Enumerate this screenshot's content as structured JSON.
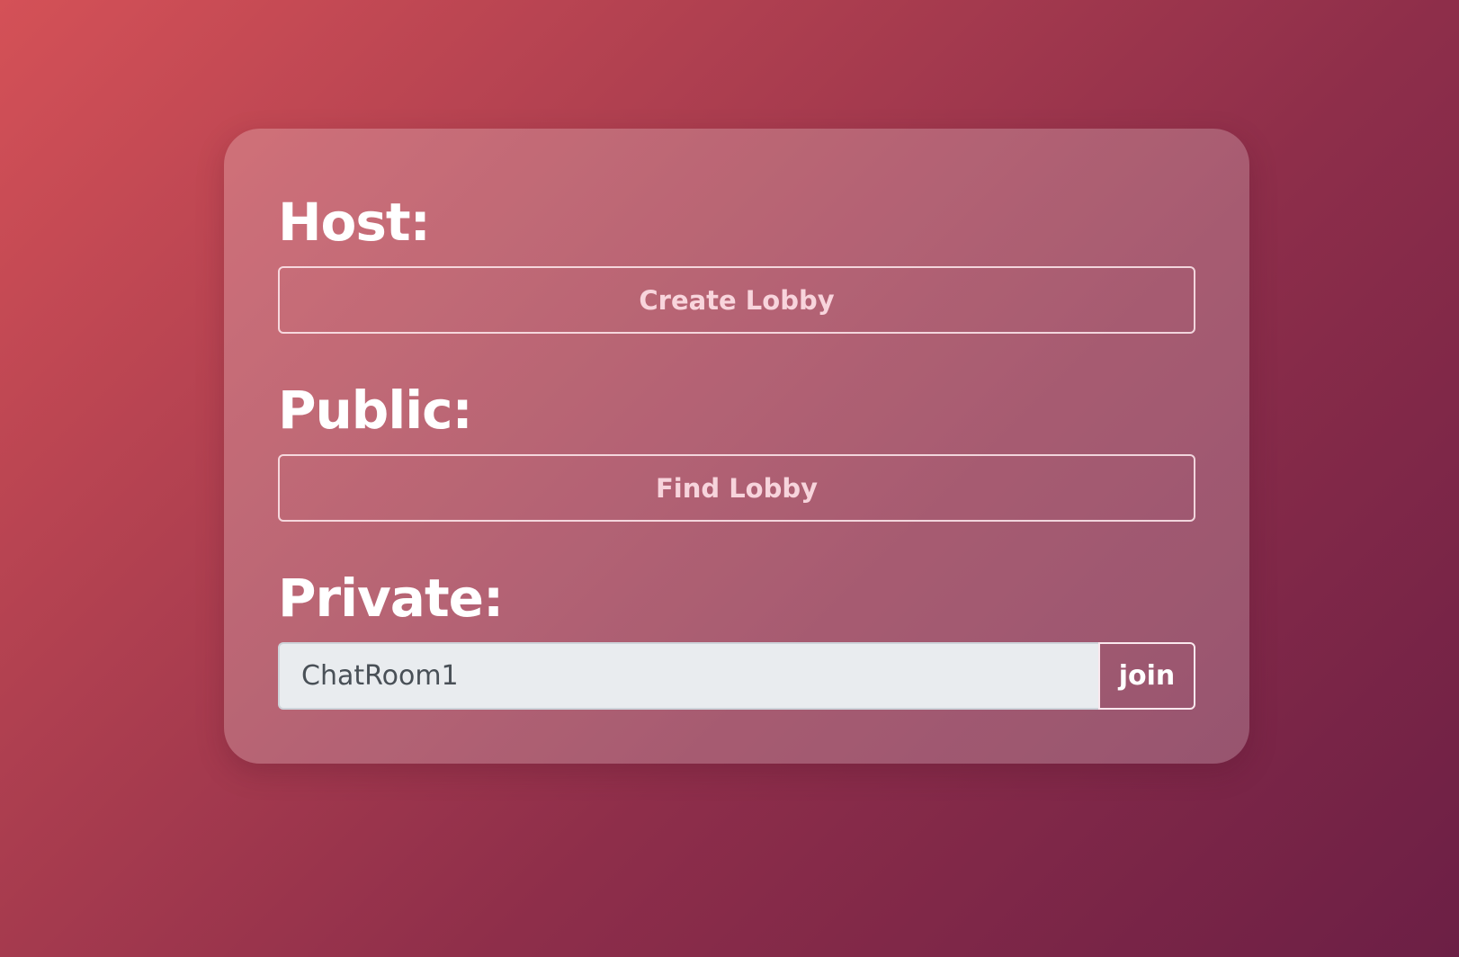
{
  "host": {
    "label": "Host:",
    "create_button_label": "Create Lobby"
  },
  "public": {
    "label": "Public:",
    "find_button_label": "Find Lobby"
  },
  "private": {
    "label": "Private:",
    "room_input_value": "ChatRoom1",
    "join_button_label": "join"
  },
  "colors": {
    "background_start": "#d45157",
    "background_end": "#6c1f45",
    "text": "#ffffff",
    "input_background": "#e9ecef"
  }
}
